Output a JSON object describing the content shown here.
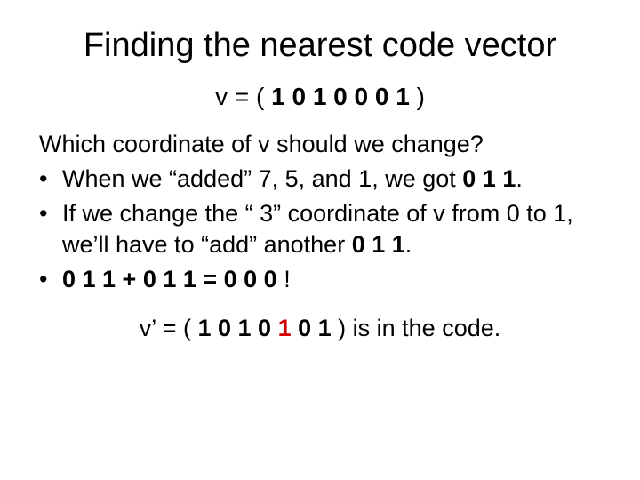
{
  "title": "Finding the nearest code vector",
  "vector": {
    "prefix": "v = ( ",
    "bits": "1 0 1 0 0 0 1",
    "suffix": " )"
  },
  "question": "Which coordinate of v should we change?",
  "bullets": [
    {
      "pre": "When we “added” 7, 5, and 1, we got  ",
      "bold": "0 1 1",
      "post": "."
    },
    {
      "pre": "If we change the “ 3” coordinate of v from 0 to 1, we’ll have to “add” another ",
      "bold": "0 1 1",
      "post": "."
    },
    {
      "pre": "",
      "bold": "0 1 1 + 0 1 1 = 0 0 0 ",
      "post": "!"
    }
  ],
  "footer": {
    "prefix": "v’ = ( ",
    "b1": "1 0 1 0 ",
    "red": "1",
    "b2": " 0 1",
    "suffix": " ) is in the code."
  }
}
